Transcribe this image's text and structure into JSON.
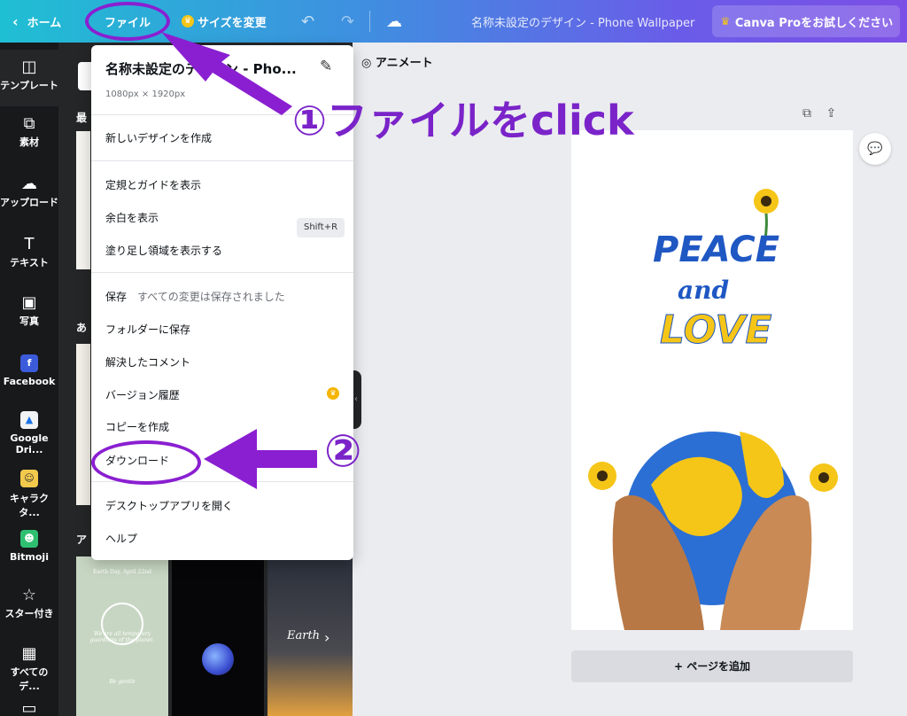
{
  "topbar": {
    "home_label": "ホーム",
    "file_label": "ファイル",
    "resize_label": "サイズを変更",
    "design_title": "名称未設定のデザイン - Phone Wallpaper",
    "pro_label": "Canva Proをお試しください"
  },
  "rail": [
    {
      "label": "テンプレート",
      "icon": "template-icon"
    },
    {
      "label": "素材",
      "icon": "elements-icon"
    },
    {
      "label": "アップロード",
      "icon": "upload-icon"
    },
    {
      "label": "テキスト",
      "icon": "text-icon"
    },
    {
      "label": "写真",
      "icon": "photo-icon"
    },
    {
      "label": "Facebook",
      "icon": "facebook-icon"
    },
    {
      "label": "Google Dri...",
      "icon": "google-drive-icon"
    },
    {
      "label": "キャラクタ...",
      "icon": "character-icon"
    },
    {
      "label": "Bitmoji",
      "icon": "bitmoji-icon"
    },
    {
      "label": "スター付き",
      "icon": "star-icon"
    },
    {
      "label": "すべてのデ...",
      "icon": "all-designs-icon"
    }
  ],
  "panel": {
    "label_1": "最",
    "label_2": "あ",
    "label_3": "ア",
    "green_thumb_title": "Earth Day, April 22nd",
    "green_thumb_body": "We are all temporary guardians of the planet.",
    "green_thumb_sign": "Be gentle",
    "hour_thumb_text": "Earth"
  },
  "editor": {
    "animate_label": "アニメート",
    "add_page_label": "+ ページを追加",
    "art_word_1": "PEACE",
    "art_word_2": "and",
    "art_word_3": "LOVE"
  },
  "menu": {
    "title": "名称未設定のデザイン - Pho...",
    "size": "1080px × 1920px",
    "new_design": "新しいデザインを作成",
    "rulers": "定規とガイドを表示",
    "rulers_shortcut": "Shift+R",
    "margins": "余白を表示",
    "bleed": "塗り足し領域を表示する",
    "save": "保存",
    "save_status": "すべての変更は保存されました",
    "save_folder": "フォルダーに保存",
    "resolved_comments": "解決したコメント",
    "version_history": "バージョン履歴",
    "make_copy": "コピーを作成",
    "download": "ダウンロード",
    "open_desktop": "デスクトップアプリを開く",
    "help": "ヘルプ"
  },
  "annotations": {
    "step1": "①ファイルをclick",
    "step2": "②"
  },
  "colors": {
    "accent": "#7b4fe6",
    "annotation": "#8a1fd1",
    "rail_bg": "#18191b",
    "panel_bg": "#252627"
  }
}
